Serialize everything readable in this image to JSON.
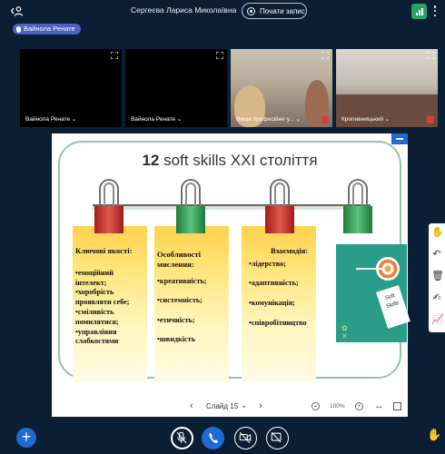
{
  "header": {
    "meeting_title": "Сергеєва Лариса Миколаївна",
    "record_label": "Почати запис",
    "users_icon": "users-toggle-icon",
    "connection_icon": "connection-status-icon",
    "more_icon": "options-icon"
  },
  "talking": {
    "label": "Вайнола Ренате"
  },
  "videos": [
    {
      "name": "Вайнола Ренате ⌄"
    },
    {
      "name": "Вайнола Ренате ⌄"
    },
    {
      "name": "Вище професійне у... ⌄"
    },
    {
      "name": "Кропивницький ⌄"
    }
  ],
  "slide": {
    "title_number": "12",
    "title_rest": " soft skills XXI століття",
    "cards": [
      {
        "heading": "Ключові якості:",
        "items": [
          "•емоційний",
          "інтелект;",
          "•хоробрість",
          "проявляти себе;",
          "•сміливість",
          "помилятися;",
          "•управління",
          "слабкостями"
        ]
      },
      {
        "heading": "Особливості мислення:",
        "items": [
          "•креативність;",
          "•системність;",
          "•етичність;",
          "•швидкість"
        ]
      },
      {
        "heading": "Взаємодія:",
        "items": [
          "•лідерство;",
          "•адаптивність;",
          "•комунікація;",
          "•співробітництво"
        ]
      }
    ],
    "tag_text": [
      "Soft",
      "Skills"
    ]
  },
  "slide_nav": {
    "slide_label": "Слайд 15",
    "zoom": "100%"
  },
  "colors": {
    "background": "#0a1e34",
    "primary": "#1f6ad4",
    "badge": "#4b61bf",
    "frame": "#93c5a8",
    "card_top": "#ffd24d",
    "teal": "#2a9d8a"
  }
}
